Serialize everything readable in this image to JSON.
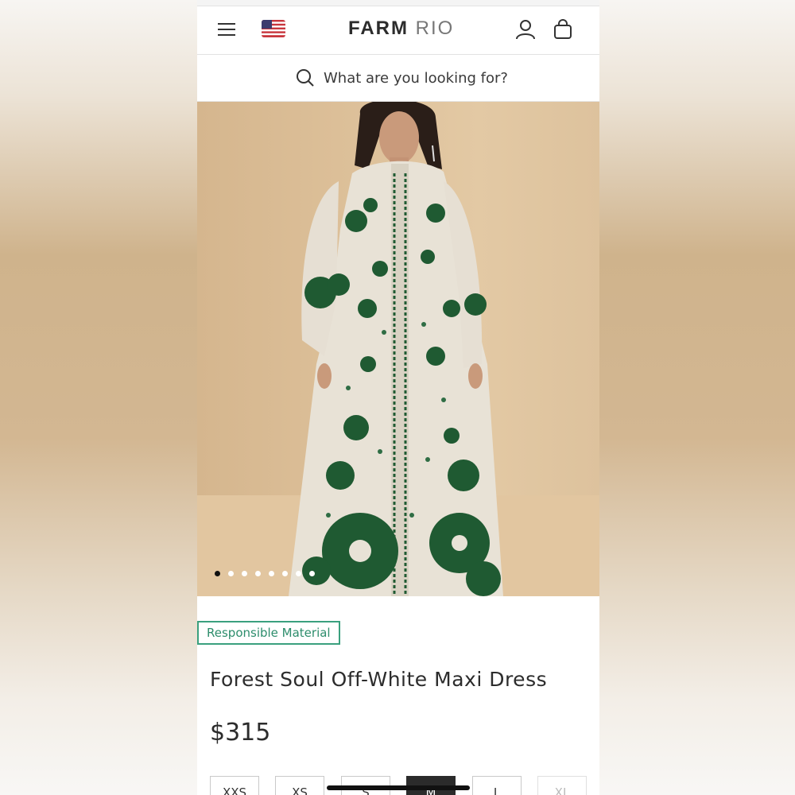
{
  "header": {
    "logo_primary": "FARM",
    "logo_secondary": "RIO",
    "menu_icon": "hamburger-icon",
    "flag_icon": "us-flag-icon",
    "account_icon": "user-icon",
    "cart_icon": "shopping-bag-icon"
  },
  "search": {
    "placeholder": "What are you looking for?",
    "icon": "search-icon"
  },
  "gallery": {
    "image_count": 8,
    "active_index": 0
  },
  "product": {
    "badge": "Responsible Material",
    "name": "Forest Soul Off-White Maxi Dress",
    "price": "$315",
    "sizes": [
      {
        "label": "XXS",
        "state": "available"
      },
      {
        "label": "XS",
        "state": "available"
      },
      {
        "label": "S",
        "state": "available"
      },
      {
        "label": "M",
        "state": "selected"
      },
      {
        "label": "L",
        "state": "available"
      },
      {
        "label": "XL",
        "state": "disabled"
      }
    ]
  },
  "colors": {
    "accent_green": "#3aa07e",
    "text_dark": "#2c2c2c",
    "dress_green": "#1f5a32"
  }
}
